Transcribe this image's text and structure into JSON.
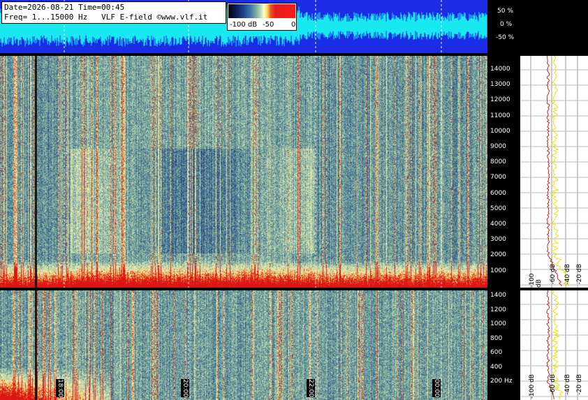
{
  "header": {
    "line1": "Date=2026-08-21 Time=00:45",
    "line2": "Freq= 1...15000 Hz   VLF E-field ©www.vlf.it"
  },
  "colorbar": {
    "labels": [
      "-100 dB",
      "-50",
      "0"
    ]
  },
  "waveform_axis": [
    "50 %",
    "0 %",
    "-50 %"
  ],
  "upper_freq_axis": [
    "14000",
    "13000",
    "12000",
    "11000",
    "10000",
    "9000",
    "8000",
    "7000",
    "6000",
    "5000",
    "4000",
    "3000",
    "2000",
    "1000"
  ],
  "lower_freq_axis": [
    "1400",
    "1200",
    "1000",
    "800",
    "600",
    "400",
    "200 Hz"
  ],
  "time_ticks": [
    "18:00",
    "20:00",
    "22:00",
    "00:00"
  ],
  "side_db_labels_upper": [
    "-100 dB",
    "-60 dB",
    "-40 dB",
    "-20 dB"
  ],
  "side_db_labels_lower": [
    "-100 dB",
    "-60 dB",
    "-40 dB",
    "-20 dB"
  ],
  "colors": {
    "waveform_bg": "#1a2ce6",
    "waveform_trace": "#19e8f0",
    "spectrum_low": "#2a4c8a",
    "spectrum_mid": "#8fb5a0",
    "spectrum_high": "#f3e79a",
    "spectrum_peak": "#e21a1a",
    "avg_line": "#d62020",
    "peak_line": "#f0e000"
  }
}
